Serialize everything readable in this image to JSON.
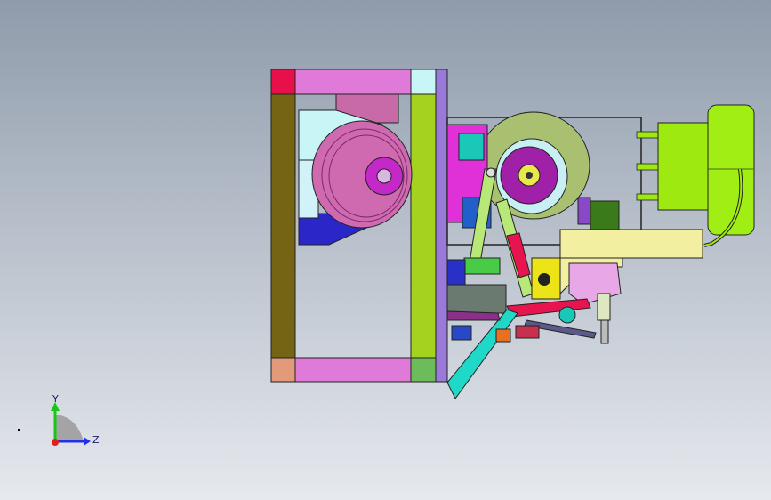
{
  "viewport": {
    "background_top": "#8f9bab",
    "background_bottom": "#e6e9ee"
  },
  "triad": {
    "y_label": "Y",
    "z_label": "Z",
    "y_color": "#16c816",
    "z_color": "#2230e6",
    "origin_color": "#e02020"
  },
  "colors": {
    "frame_olive": "#756414",
    "frame_pink": "#e07ad8",
    "frame_red": "#e8104a",
    "frame_cyan": "#c8f6f6",
    "frame_lime": "#a4d21e",
    "frame_salmon": "#e29a7a",
    "frame_green": "#6cbc5c",
    "frame_purple": "#9a7ad8",
    "pulley_pink": "#d06ab0",
    "pulley_magenta": "#c428c8",
    "wheel_green": "#a8c070",
    "motor_lime": "#9eea10",
    "bracket_yellow": "#f2f0a0",
    "teal": "#1ac8b8"
  }
}
